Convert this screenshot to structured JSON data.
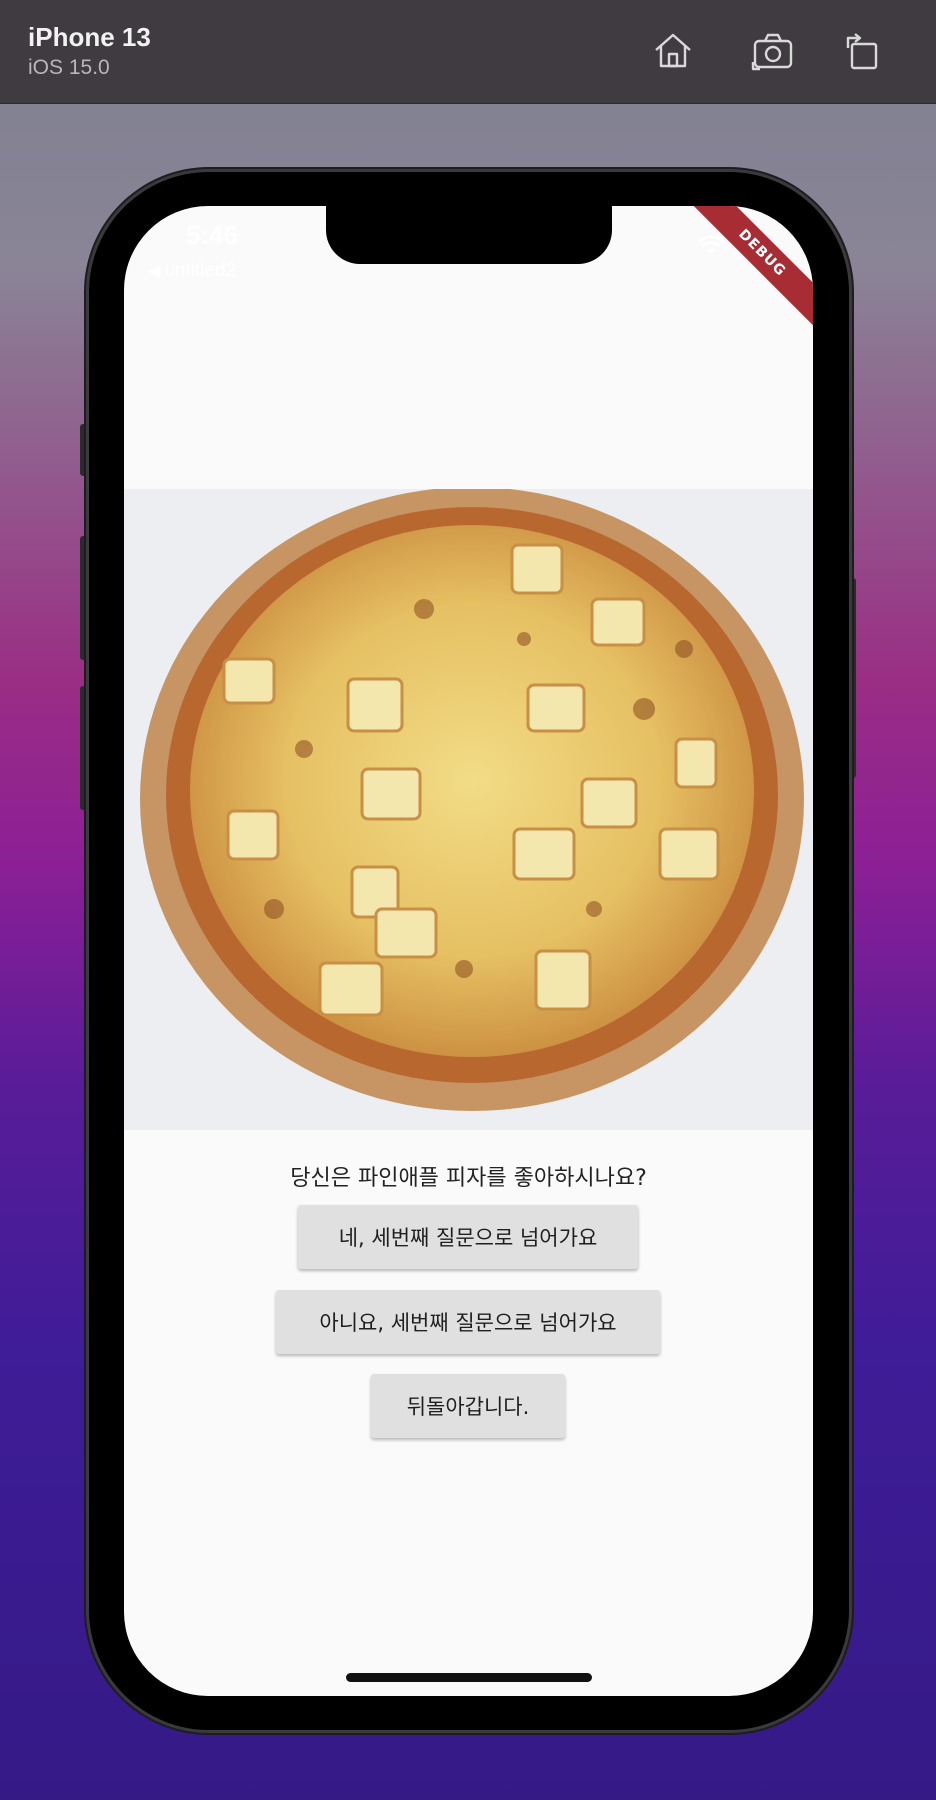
{
  "simulator": {
    "device_name": "iPhone 13",
    "os_version": "iOS 15.0",
    "toolbar_icons": [
      "home-icon",
      "screenshot-icon",
      "rotate-icon"
    ]
  },
  "status_bar": {
    "time": "5:46",
    "back_label": "untitled2",
    "debug_banner": "DEBUG"
  },
  "content": {
    "image": "pineapple-pizza-photo",
    "question": "당신은 파인애플 피자를 좋아하시나요?",
    "buttons": {
      "yes": "네, 세번째 질문으로 넘어가요",
      "no": "아니요, 세번째 질문으로 넘어가요",
      "back": "뒤돌아갑니다."
    }
  },
  "colors": {
    "toolbar": "#403b41",
    "debug_banner": "#a72c34",
    "button_bg": "#e0e0e0",
    "screen_bg": "#fafafa"
  }
}
